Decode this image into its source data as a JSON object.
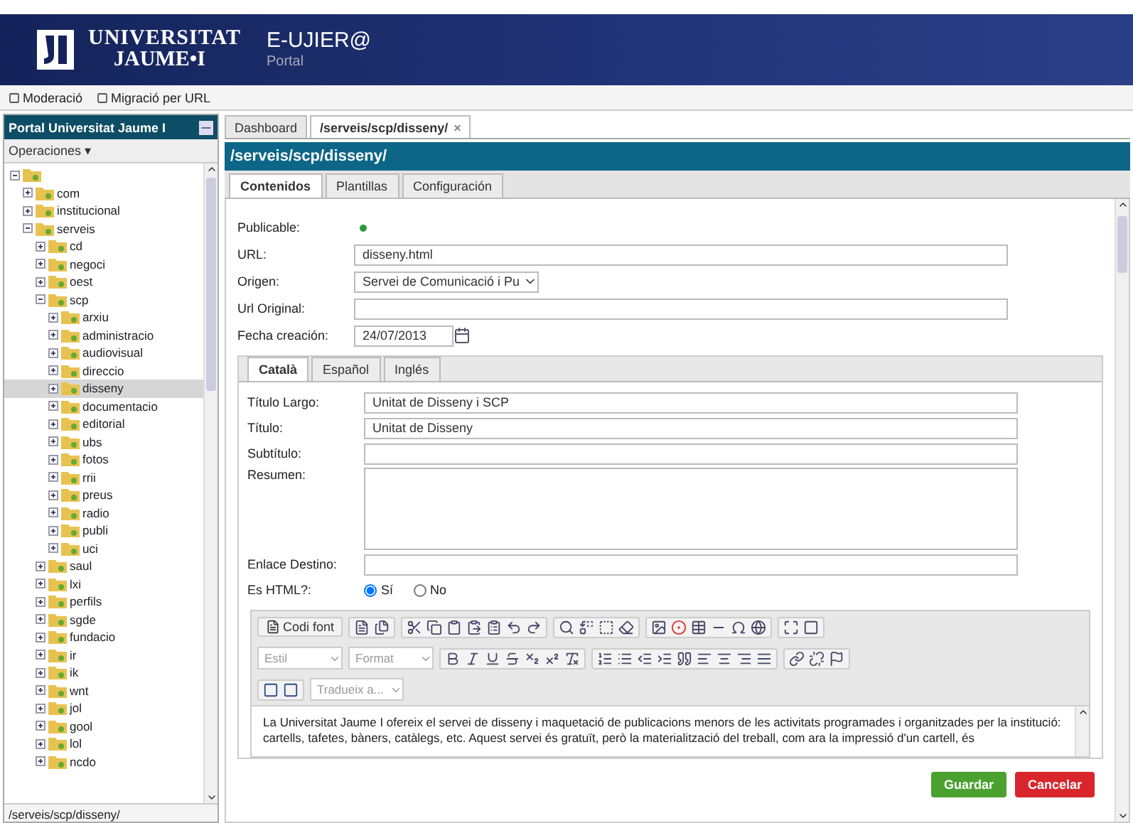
{
  "header": {
    "logo_line_1": "UNIVERSITAT",
    "logo_line_2": "JAUME•I",
    "app_name": "E-UJIER@",
    "app_subtitle": "Portal"
  },
  "toolbar": [
    "Moderació",
    "Migració per URL"
  ],
  "sidebar": {
    "title": "Portal Universitat Jaume I",
    "operations": "Operaciones ▾",
    "status": "/serveis/scp/disseny/",
    "tree": [
      {
        "expanded": true,
        "selected": false,
        "children": [
          {
            "label": "com",
            "expanded": false,
            "selected": false
          },
          {
            "label": "institucional",
            "expanded": false,
            "selected": false
          },
          {
            "label": "serveis",
            "expanded": true,
            "selected": false,
            "children": [
              {
                "label": "cd",
                "expanded": false,
                "selected": false
              },
              {
                "label": "negoci",
                "expanded": false,
                "selected": false
              },
              {
                "label": "oest",
                "expanded": false,
                "selected": false
              },
              {
                "label": "scp",
                "expanded": true,
                "selected": false,
                "children": [
                  {
                    "label": "arxiu",
                    "expanded": false,
                    "selected": false
                  },
                  {
                    "label": "administracio",
                    "expanded": false,
                    "selected": false
                  },
                  {
                    "label": "audiovisual",
                    "expanded": false,
                    "selected": false
                  },
                  {
                    "label": "direccio",
                    "expanded": false,
                    "selected": false
                  },
                  {
                    "label": "disseny",
                    "expanded": false,
                    "selected": true
                  },
                  {
                    "label": "documentacio",
                    "expanded": false,
                    "selected": false
                  },
                  {
                    "label": "editorial",
                    "expanded": false,
                    "selected": false
                  },
                  {
                    "label": "ubs",
                    "expanded": false,
                    "selected": false
                  },
                  {
                    "label": "fotos",
                    "expanded": false,
                    "selected": false
                  },
                  {
                    "label": "rrii",
                    "expanded": false,
                    "selected": false
                  },
                  {
                    "label": "preus",
                    "expanded": false,
                    "selected": false
                  },
                  {
                    "label": "radio",
                    "expanded": false,
                    "selected": false
                  },
                  {
                    "label": "publi",
                    "expanded": false,
                    "selected": false
                  },
                  {
                    "label": "uci",
                    "expanded": false,
                    "selected": false
                  }
                ]
              },
              {
                "label": "saul",
                "expanded": false,
                "selected": false
              },
              {
                "label": "lxi",
                "expanded": false,
                "selected": false
              },
              {
                "label": "perfils",
                "expanded": false,
                "selected": false
              },
              {
                "label": "sgde",
                "expanded": false,
                "selected": false
              },
              {
                "label": "fundacio",
                "expanded": false,
                "selected": false
              },
              {
                "label": "ir",
                "expanded": false,
                "selected": false
              },
              {
                "label": "ik",
                "expanded": false,
                "selected": false
              },
              {
                "label": "wnt",
                "expanded": false,
                "selected": false
              },
              {
                "label": "jol",
                "expanded": false,
                "selected": false
              },
              {
                "label": "gool",
                "expanded": false,
                "selected": false
              },
              {
                "label": "lol",
                "expanded": false,
                "selected": false
              },
              {
                "label": "ncdo",
                "expanded": false,
                "selected": false
              }
            ]
          }
        ]
      }
    ]
  },
  "doc_tabs": [
    {
      "label": "Dashboard",
      "selected": false,
      "closable": false
    },
    {
      "label": "/serveis/scp/disseny/",
      "selected": true,
      "closable": true,
      "close": "×"
    }
  ],
  "panel_title": "/serveis/scp/disseny/",
  "content_tabs": [
    {
      "label": "Contenidos",
      "selected": true
    },
    {
      "label": "Plantillas",
      "selected": false
    },
    {
      "label": "Configuración",
      "selected": false
    }
  ],
  "fields": [
    {
      "kind": "indicator",
      "label": "Publicable:",
      "on": true
    },
    {
      "kind": "text",
      "label": "URL:",
      "value": "disseny.html"
    },
    {
      "kind": "select",
      "label": "Origen:",
      "value": "Servei de Comunicació i Pu"
    },
    {
      "kind": "text",
      "label": "Url Original:"
    },
    {
      "kind": "date",
      "label": "Fecha creación:",
      "value": "24/07/2013"
    }
  ],
  "language_tabs": [
    {
      "label": "Català",
      "selected": true
    },
    {
      "label": "Español",
      "selected": false
    },
    {
      "label": "Inglés",
      "selected": false
    }
  ],
  "language_fields": [
    {
      "kind": "text",
      "label": "Título Largo:",
      "value": "Unitat de Disseny i SCP"
    },
    {
      "kind": "text",
      "label": "Título:",
      "value": "Unitat de Disseny"
    },
    {
      "kind": "text",
      "label": "Subtítulo:"
    },
    {
      "kind": "textarea",
      "label": "Resumen:"
    },
    {
      "kind": "text",
      "label": "Enlace Destino:"
    }
  ],
  "html_choice": {
    "label": "Es HTML?:",
    "options": [
      {
        "label": "Sí",
        "selected": true
      },
      {
        "label": "No",
        "selected": false
      }
    ]
  },
  "editor": {
    "source_button": "Codi font",
    "style_select": "Estil",
    "format_select": "Format",
    "translate_select": "Tradueix a...",
    "body": "La Universitat Jaume I ofereix el servei de disseny i maquetació de publicacions menors de les activitats programades i organitzades per la institució: cartells, tafetes, bàners, catàlegs, etc. Aquest servei és gratuït, però la materialització del treball, com ara la impressió d'un cartell, és"
  },
  "buttons": [
    {
      "kind": "save",
      "label": "Guardar"
    },
    {
      "kind": "cancel",
      "label": "Cancelar"
    }
  ]
}
